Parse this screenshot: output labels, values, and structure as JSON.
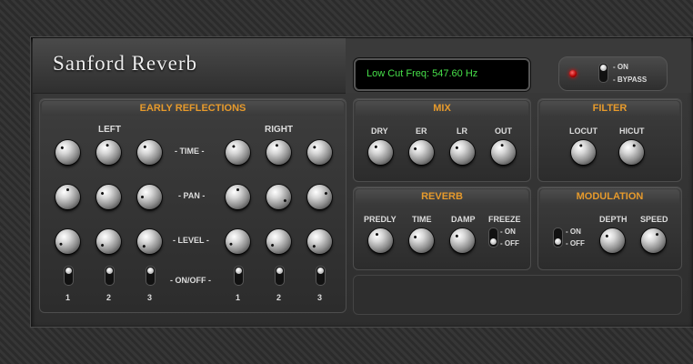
{
  "app": {
    "title": "Sanford Reverb"
  },
  "display": {
    "text": "Low Cut Freq: 547.60 Hz",
    "color": "#47e04a"
  },
  "bypass": {
    "on_label": "- ON",
    "bypass_label": "- BYPASS",
    "state": "on"
  },
  "early_reflections": {
    "title": "EARLY REFLECTIONS",
    "left_label": "LEFT",
    "right_label": "RIGHT",
    "rows": {
      "time": "- TIME -",
      "pan": "- PAN -",
      "level": "- LEVEL -",
      "onoff": "- ON/OFF -"
    },
    "channel_numbers": [
      "1",
      "2",
      "3"
    ]
  },
  "mix": {
    "title": "MIX",
    "knobs": [
      "DRY",
      "ER",
      "LR",
      "OUT"
    ]
  },
  "filter": {
    "title": "FILTER",
    "knobs": [
      "LOCUT",
      "HICUT"
    ]
  },
  "reverb": {
    "title": "REVERB",
    "knobs": [
      "PREDLY",
      "TIME",
      "DAMP"
    ],
    "freeze_label": "FREEZE",
    "on_label": "- ON",
    "off_label": "- OFF"
  },
  "modulation": {
    "title": "MODULATION",
    "on_label": "- ON",
    "off_label": "- OFF",
    "knobs": [
      "DEPTH",
      "SPEED"
    ]
  },
  "colors": {
    "accent": "#e69a2c",
    "led": "#d00000"
  }
}
